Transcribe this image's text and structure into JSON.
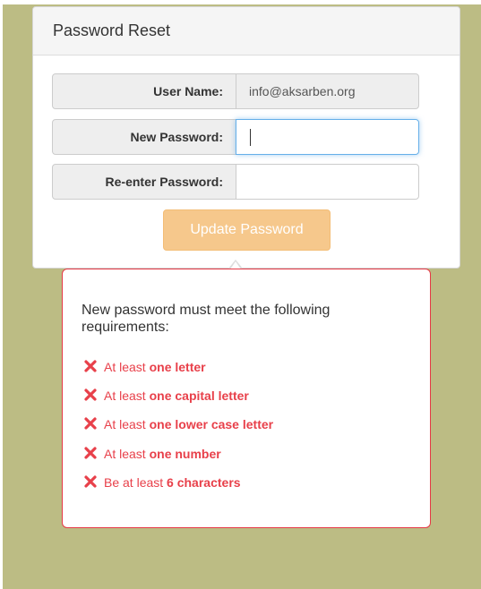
{
  "colors": {
    "background": "#bcbc84",
    "button": "#f6c88c",
    "error": "#e8404a",
    "focus": "#66afe9"
  },
  "panel": {
    "title": "Password Reset"
  },
  "form": {
    "username_label": "User Name:",
    "username_value": "info@aksarben.org",
    "new_password_label": "New Password:",
    "new_password_value": "",
    "reenter_password_label": "Re-enter Password:",
    "reenter_password_value": "",
    "update_button_label": "Update Password"
  },
  "requirements": {
    "intro": "New password must meet the following requirements:",
    "items": [
      {
        "icon": "x-icon",
        "prefix": "At least ",
        "emphasis": "one letter"
      },
      {
        "icon": "x-icon",
        "prefix": "At least ",
        "emphasis": "one capital letter"
      },
      {
        "icon": "x-icon",
        "prefix": "At least ",
        "emphasis": "one lower case letter"
      },
      {
        "icon": "x-icon",
        "prefix": "At least ",
        "emphasis": "one number"
      },
      {
        "icon": "x-icon",
        "prefix": "Be at least ",
        "emphasis": "6 characters"
      }
    ]
  }
}
